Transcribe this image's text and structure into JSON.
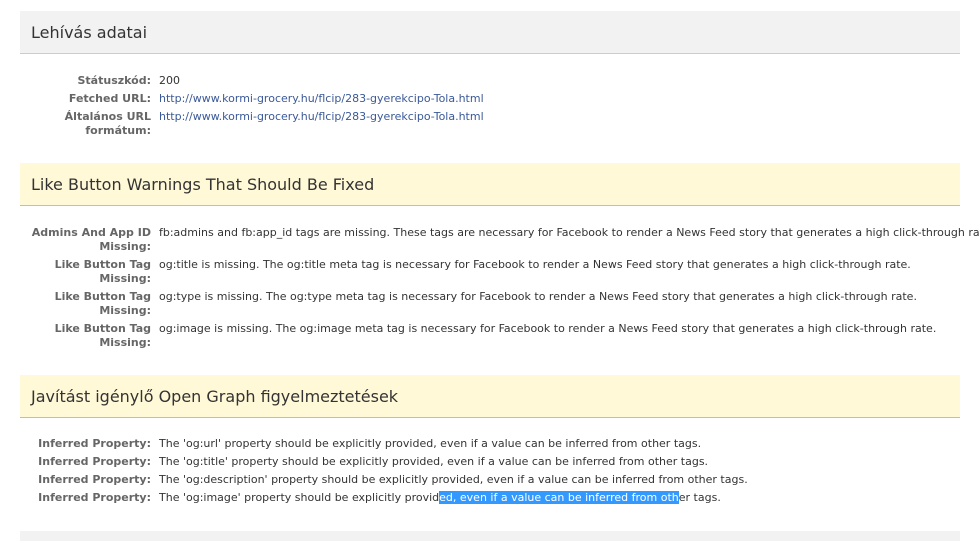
{
  "fetch_section": {
    "title": "Lehívás adatai",
    "rows": [
      {
        "label": "Státuszkód:",
        "value": "200"
      },
      {
        "label": "Fetched URL:",
        "value": "http://www.kormi-grocery.hu/flcip/283-gyerekcipo-Tola.html"
      },
      {
        "label": "Általános URL formátum:",
        "value": "http://www.kormi-grocery.hu/flcip/283-gyerekcipo-Tola.html"
      }
    ]
  },
  "like_warnings": {
    "title": "Like Button Warnings That Should Be Fixed",
    "rows": [
      {
        "label": "Admins And App ID Missing:",
        "value": "fb:admins and fb:app_id tags are missing. These tags are necessary for Facebook to render a News Feed story that generates a high click-through rate."
      },
      {
        "label": "Like Button Tag Missing:",
        "value": "og:title is missing. The og:title meta tag is necessary for Facebook to render a News Feed story that generates a high click-through rate."
      },
      {
        "label": "Like Button Tag Missing:",
        "value": "og:type is missing. The og:type meta tag is necessary for Facebook to render a News Feed story that generates a high click-through rate."
      },
      {
        "label": "Like Button Tag Missing:",
        "value": "og:image is missing. The og:image meta tag is necessary for Facebook to render a News Feed story that generates a high click-through rate."
      }
    ]
  },
  "og_warnings": {
    "title": "Javítást igénylő Open Graph figyelmeztetések",
    "rows": [
      {
        "label": "Inferred Property:",
        "value": "The 'og:url' property should be explicitly provided, even if a value can be inferred from other tags."
      },
      {
        "label": "Inferred Property:",
        "value": "The 'og:title' property should be explicitly provided, even if a value can be inferred from other tags."
      },
      {
        "label": "Inferred Property:",
        "value": "The 'og:description' property should be explicitly provided, even if a value can be inferred from other tags."
      },
      {
        "label": "Inferred Property:",
        "value_before": "The 'og:image' property should be explicitly provid",
        "value_selected": "ed, even if a value can be inferred from oth",
        "value_after": "er tags."
      }
    ]
  },
  "colors": {
    "link": "#3b5998",
    "warning_header_bg": "#fff9d7",
    "warning_header_border": "#e2c822",
    "selection": "#3399ff"
  }
}
